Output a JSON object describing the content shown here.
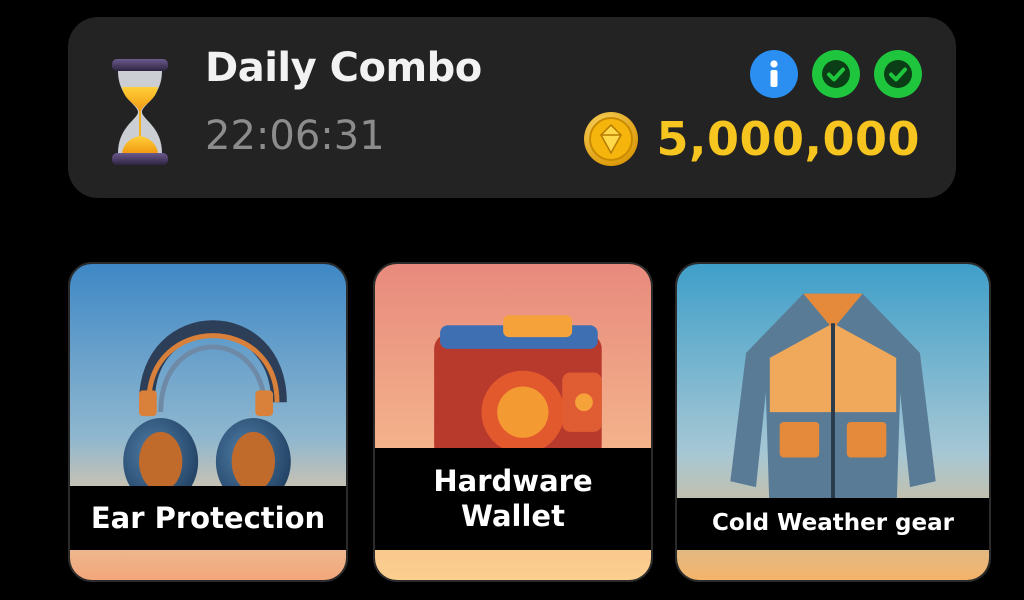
{
  "combo": {
    "title": "Daily Combo",
    "timer": "22:06:31",
    "reward": "5,000,000",
    "icons": {
      "timer": "hourglass-icon",
      "info": "info-icon",
      "completed": [
        "check-icon",
        "check-icon"
      ],
      "currency": "gold-coin-icon"
    }
  },
  "cards": [
    {
      "label": "Ear Protection",
      "image": "headphones-illustration"
    },
    {
      "label": "Hardware Wallet",
      "image": "wallet-illustration"
    },
    {
      "label": "Cold Weather gear",
      "image": "jacket-illustration"
    }
  ],
  "colors": {
    "background": "#000000",
    "card": "#232323",
    "title": "#f2f2f2",
    "timer": "#8c8c8c",
    "reward": "#f7c51f",
    "info_badge": "#2a8ff0",
    "check_badge": "#1ec53d"
  }
}
